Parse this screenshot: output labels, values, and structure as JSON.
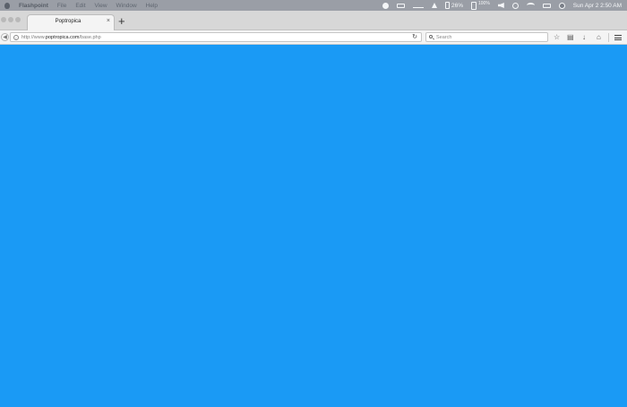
{
  "menubar": {
    "app_name": "Flashpoint",
    "menus": [
      "File",
      "Edit",
      "View",
      "Window",
      "Help"
    ],
    "battery_percent": "26%",
    "battery2_percent": "100%",
    "clock": "Sun Apr 2  2:50 AM",
    "icons": [
      "globe-icon",
      "display-icon",
      "signal-icon",
      "upload-icon",
      "battery-icon",
      "battery-icon",
      "speaker-icon",
      "clock-icon",
      "wifi-icon",
      "screen-icon",
      "user-icon"
    ]
  },
  "browser": {
    "tab": {
      "title": "Poptropica",
      "close": "×"
    },
    "new_tab": "+",
    "url": {
      "prefix": "http://www.",
      "domain": "poptropica.com",
      "path": "/base.php"
    },
    "search": {
      "placeholder": "Search"
    },
    "toolbar_icons": [
      "bookmark-star-icon",
      "clipboard-icon",
      "download-icon",
      "home-icon",
      "menu-icon"
    ]
  },
  "page": {
    "background": "#1a9af5"
  }
}
